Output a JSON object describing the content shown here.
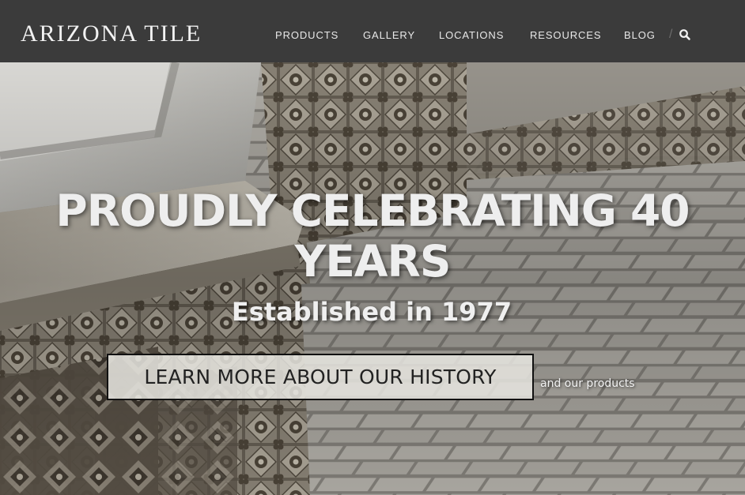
{
  "header": {
    "logo_text": "ARIZONA TILE",
    "nav": {
      "products": "PRODUCTS",
      "gallery": "GALLERY",
      "locations": "LOCATIONS",
      "resources": "RESOURCES",
      "blog": "BLOG"
    },
    "divider": "/",
    "search_icon": "search-icon"
  },
  "hero": {
    "title": "PROUDLY CELEBRATING 40 YEARS",
    "subtitle": "Established in 1977",
    "cta_label": "LEARN MORE ABOUT OUR HISTORY",
    "cta_note": "and our products"
  },
  "colors": {
    "header_bg": "#3b3b3b",
    "nav_text": "#e8e8e8",
    "hero_text": "#eeeeee",
    "cta_bg": "#e7e5df",
    "cta_border": "#111111"
  }
}
